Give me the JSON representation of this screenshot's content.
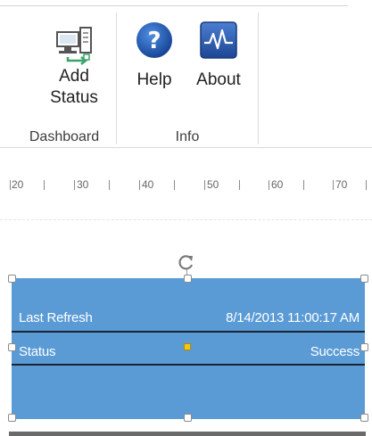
{
  "ribbon": {
    "groups": [
      {
        "label": "Dashboard",
        "buttons": [
          {
            "line1": "Add",
            "line2": "Status",
            "icon": "add-status-icon"
          }
        ]
      },
      {
        "label": "Info",
        "buttons": [
          {
            "label": "Help",
            "icon": "help-icon"
          },
          {
            "label": "About",
            "icon": "about-icon"
          }
        ]
      }
    ],
    "colors": {
      "help_blue": "#1f5fbf",
      "about_blue": "#2b61b8",
      "add_green": "#3aa36a"
    }
  },
  "ruler": {
    "ticks": [
      "20",
      "30",
      "40",
      "50",
      "60",
      "70"
    ]
  },
  "shape": {
    "fill": "#5b9bd5",
    "rows": [
      {
        "label": "Last Refresh",
        "value": "8/14/2013 11:00:17 AM"
      },
      {
        "label": "Status",
        "value": "Success"
      }
    ]
  }
}
